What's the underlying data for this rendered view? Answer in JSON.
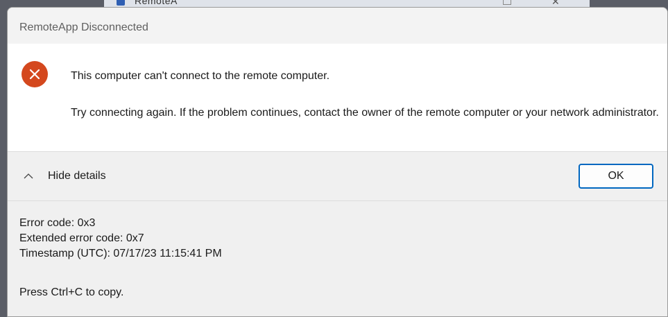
{
  "background_window": {
    "title": "RemoteA"
  },
  "dialog": {
    "title": "RemoteApp Disconnected",
    "icon": "error-x-icon",
    "main_instruction": "This computer can't connect to the remote computer.",
    "content": "Try connecting again. If the problem continues, contact the owner of the remote computer or your network administrator.",
    "toggle_label": "Hide details",
    "ok_label": "OK",
    "details": {
      "error_code": "Error code: 0x3",
      "extended_error_code": "Extended error code: 0x7",
      "timestamp": "Timestamp (UTC): 07/17/23 11:15:41 PM",
      "copy_hint": "Press Ctrl+C to copy."
    }
  },
  "colors": {
    "error_icon": "#d4481e",
    "ok_border": "#0067c0",
    "dialog_background": "#f0f0f0",
    "content_background": "#ffffff"
  }
}
